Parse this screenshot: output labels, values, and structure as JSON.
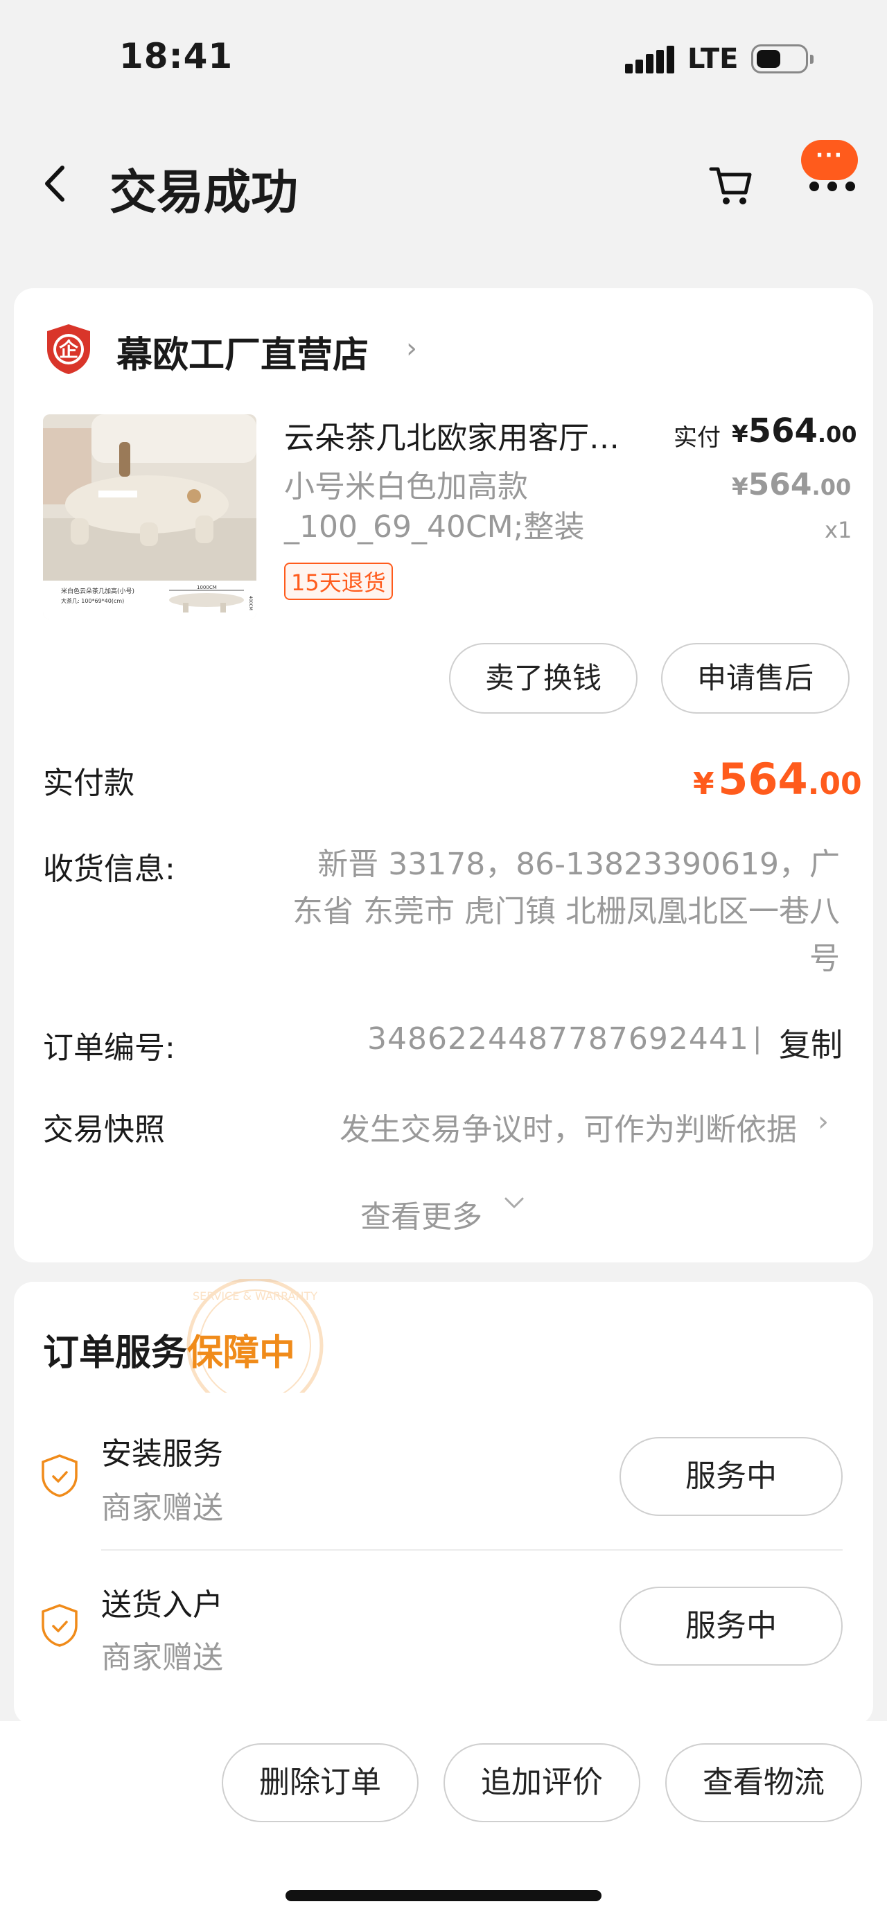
{
  "status_bar": {
    "time": "18:41",
    "network": "LTE"
  },
  "header": {
    "title": "交易成功",
    "more_icon_text": "···"
  },
  "shop": {
    "name": "幕欧工厂直营店",
    "logo_text": "企"
  },
  "product": {
    "name": "云朵茶几北欧家用客厅小户型",
    "spec": "小号米白色加高款_100_69_40CM;整装",
    "paid_label": "实付",
    "currency": "¥",
    "paid_int": "564",
    "paid_dec": ".00",
    "orig_int": "564",
    "orig_dec": ".00",
    "qty": "x1",
    "return_badge": "15天退货",
    "image_caption_1": "米白色云朵茶几加高(小号)",
    "image_caption_2": "大茶几: 100*69*40(cm)",
    "image_dim_w": "1000CM",
    "image_dim_h": "400CM"
  },
  "actions": {
    "sell": "卖了换钱",
    "after_sale": "申请售后"
  },
  "payment": {
    "label": "实付款",
    "currency": "¥",
    "amount_int": "564",
    "amount_dec": ".00"
  },
  "address": {
    "label": "收货信息:",
    "value": "新晋 33178，86-13823390619，广东省 东莞市 虎门镇 北栅凤凰北区一巷八号"
  },
  "order": {
    "label": "订单编号:",
    "number": "3486224487787692441",
    "sep": "|",
    "copy": "复制"
  },
  "snapshot": {
    "label": "交易快照",
    "value": "发生交易争议时，可作为判断依据"
  },
  "see_more": "查看更多",
  "service": {
    "title_main": "订单服务",
    "title_highlight": "保障中",
    "stamp_text": "SERVICE & WARRANTY",
    "items": [
      {
        "name": "安装服务",
        "sub": "商家赠送",
        "status": "服务中"
      },
      {
        "name": "送货入户",
        "sub": "商家赠送",
        "status": "服务中"
      }
    ]
  },
  "bottom_bar": {
    "delete": "删除订单",
    "review": "追加评价",
    "logistics": "查看物流"
  },
  "colors": {
    "accent": "#ff5b1c",
    "highlight": "#f08b1a",
    "muted": "#999999"
  }
}
